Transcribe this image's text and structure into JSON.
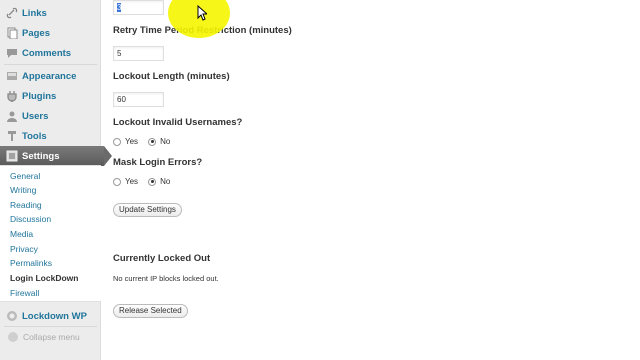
{
  "sidebar": {
    "items": [
      {
        "label": "Links",
        "icon": "links-icon"
      },
      {
        "label": "Pages",
        "icon": "pages-icon"
      },
      {
        "label": "Comments",
        "icon": "comments-icon"
      },
      {
        "label": "Appearance",
        "icon": "appearance-icon"
      },
      {
        "label": "Plugins",
        "icon": "plugins-icon"
      },
      {
        "label": "Users",
        "icon": "users-icon"
      },
      {
        "label": "Tools",
        "icon": "tools-icon"
      },
      {
        "label": "Settings",
        "icon": "settings-icon",
        "active": true
      }
    ],
    "submenu": [
      "General",
      "Writing",
      "Reading",
      "Discussion",
      "Media",
      "Privacy",
      "Permalinks",
      "Login LockDown",
      "Firewall"
    ],
    "current_submenu": "Login LockDown",
    "plugin_item": {
      "label": "Lockdown WP",
      "icon": "lockdown-icon"
    },
    "collapse_label": "Collapse menu"
  },
  "form": {
    "first_input_value": "3",
    "retry_label": "Retry Time Period Restriction (minutes)",
    "retry_value": "5",
    "lockout_label": "Lockout Length (minutes)",
    "lockout_value": "60",
    "invalid_usernames_label": "Lockout Invalid Usernames?",
    "mask_errors_label": "Mask Login Errors?",
    "yes_label": "Yes",
    "no_label": "No",
    "invalid_usernames_selected": "No",
    "mask_errors_selected": "No",
    "update_button": "Update Settings"
  },
  "locked_out": {
    "heading": "Currently Locked Out",
    "message": "No current IP blocks locked out.",
    "release_button": "Release Selected"
  },
  "colors": {
    "link": "#21759b",
    "active_menu": "#6a6a6a",
    "highlight": "#f5f500"
  }
}
